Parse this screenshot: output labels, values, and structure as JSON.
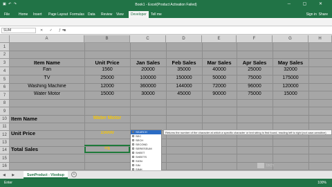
{
  "window": {
    "title": "Book1 - Excel(Product Activation Failed)",
    "qat_icons": [
      "save-icon",
      "undo-icon",
      "redo-icon"
    ],
    "buttons": [
      "minimize",
      "maximize",
      "close"
    ]
  },
  "ribbon": {
    "tabs": [
      "File",
      "Home",
      "Insert",
      "Page Layout",
      "Formulas",
      "Data",
      "Review",
      "View",
      "Developer"
    ],
    "active_tab": "Developer",
    "tell_me": "Tell me",
    "sign_in": "Sign in",
    "share": "Share"
  },
  "formula_bar": {
    "name_box": "SUM",
    "fx_icons": [
      "cancel",
      "enter",
      "fx"
    ],
    "value": "=s"
  },
  "columns": [
    "A",
    "B",
    "C",
    "D",
    "E",
    "F",
    "G",
    "H"
  ],
  "rows": [
    "1",
    "2",
    "3",
    "4",
    "5",
    "6",
    "7",
    "8",
    "9",
    "10",
    "11",
    "12",
    "13",
    "14",
    "15",
    "16"
  ],
  "table": {
    "headers": [
      "Item Name",
      "Unit Price",
      "Jan Sales",
      "Feb Sales",
      "Mar Sales",
      "Apr Sales",
      "May Sales"
    ],
    "rows": [
      [
        "Fan",
        "1560",
        "20000",
        "35000",
        "40000",
        "25000",
        "32000"
      ],
      [
        "TV",
        "25000",
        "100000",
        "150000",
        "50000",
        "75000",
        "175000"
      ],
      [
        "Washing Machine",
        "12000",
        "360000",
        "144000",
        "72000",
        "96000",
        "120000"
      ],
      [
        "Water Motor",
        "15000",
        "30000",
        "45000",
        "90000",
        "75000",
        "15000"
      ]
    ]
  },
  "lookup": {
    "item_label": "Item Name",
    "item_value": "Water Motor",
    "price_label": "Unit Price",
    "price_value": "15000",
    "total_label": "Total Sales",
    "total_value": "=s"
  },
  "autocomplete": {
    "items": [
      "SEARCH",
      "SEC",
      "SECH",
      "SECOND",
      "SERIESSUM",
      "SHEET",
      "SHEETS",
      "SIGN",
      "SIN",
      "SINH",
      "SKEW",
      "SKEW.P"
    ],
    "selected": 0,
    "tooltip": "Returns the number of the character at which a specific character or text string is first found, reading left to right (not case-sensitive)"
  },
  "sheet_tabs": {
    "active": "SumProduct - Vlookup",
    "add_label": "+"
  },
  "status": {
    "mode": "Enter",
    "zoom": "100%"
  },
  "watermark": "tech"
}
